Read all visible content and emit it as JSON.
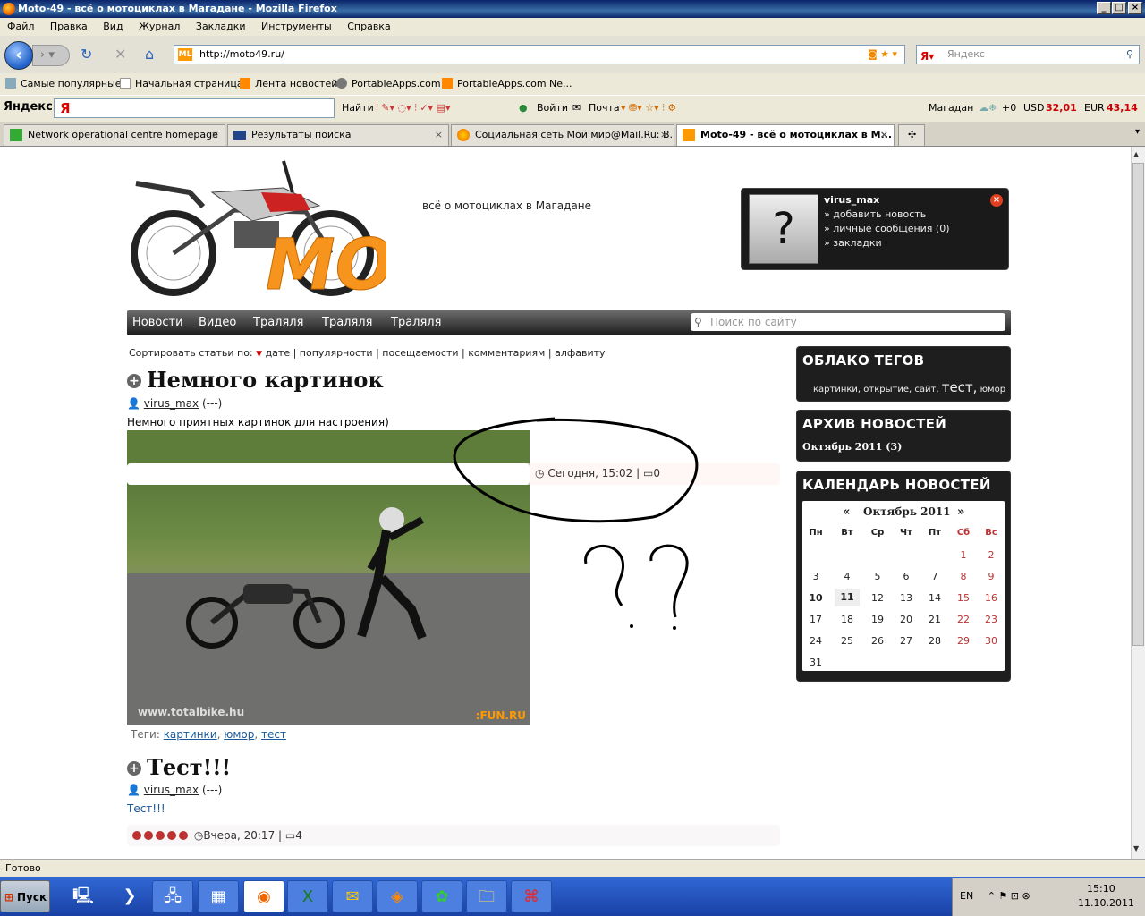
{
  "window": {
    "title": "Moto-49 - всё о мотоциклах в Магадане - Mozilla Firefox"
  },
  "menu": [
    "Файл",
    "Правка",
    "Вид",
    "Журнал",
    "Закладки",
    "Инструменты",
    "Справка"
  ],
  "nav": {
    "url": "http://moto49.ru/",
    "search_placeholder": "Яндекс"
  },
  "bookmarks": [
    "Самые популярные",
    "Начальная страница",
    "Лента новостей",
    "PortableApps.com",
    "PortableApps.com Ne..."
  ],
  "yabar": {
    "logo": "Яндекс",
    "find": "Найти",
    "login": "Войти",
    "mail": "Почта",
    "city": "Магадан",
    "temp": "+0",
    "usd_label": "USD",
    "usd": "32,01",
    "eur_label": "EUR",
    "eur": "43,14"
  },
  "tabs": [
    {
      "label": "Network operational centre homepage"
    },
    {
      "label": "Результаты поиска"
    },
    {
      "label": "Социальная сеть Мой мир@Mail.Ru: В..."
    },
    {
      "label": "Moto-49 - всё о мотоциклах в М..."
    }
  ],
  "status": "Готово",
  "taskbar": {
    "start": "Пуск",
    "lang": "EN",
    "time": "15:10",
    "date": "11.10.2011"
  },
  "site": {
    "slogan": "всё о мотоциклах в Магадане",
    "user": {
      "name": "virus_max",
      "links": [
        "» добавить новость",
        "» личные сообщения (0)",
        "» закладки"
      ]
    },
    "menu": [
      "Новости",
      "Видео",
      "Траляля",
      "Траляля",
      "Траляля"
    ],
    "search_placeholder": "Поиск по сайту",
    "sort": {
      "label": "Сортировать статьи по:",
      "options": [
        "дате",
        "популярности",
        "посещаемости",
        "комментариям",
        "алфавиту"
      ]
    },
    "posts": [
      {
        "title": "Немного картинок",
        "author": "virus_max",
        "extra": "(---)",
        "text": "Немного приятных картинок для настроения)",
        "pic_wm": "www.totalbike.hu",
        "pic_wm2": ":FUN.RU",
        "time": "Сегодня, 15:02",
        "comments": "0",
        "tags_label": "Теги:",
        "tags": [
          "картинки",
          "юмор",
          "тест"
        ]
      },
      {
        "title": "Тест!!!",
        "author": "virus_max",
        "extra": "(---)",
        "text": "Тест!!!",
        "time": "Вчера, 20:17",
        "comments": "4"
      }
    ],
    "tagcloud": {
      "title": "ОБЛАКО ТЕГОВ",
      "tags": [
        "картинки,",
        "открытие,",
        "сайт,",
        "тест,",
        "юмор"
      ]
    },
    "archive": {
      "title": "АРХИВ НОВОСТЕЙ",
      "item": "Октябрь 2011 (3)"
    },
    "calendar": {
      "title": "КАЛЕНДАРЬ НОВОСТЕЙ",
      "month": "Октябрь 2011",
      "prev": "«",
      "next": "»",
      "days": [
        "Пн",
        "Вт",
        "Ср",
        "Чт",
        "Пт",
        "Сб",
        "Вс"
      ]
    }
  }
}
